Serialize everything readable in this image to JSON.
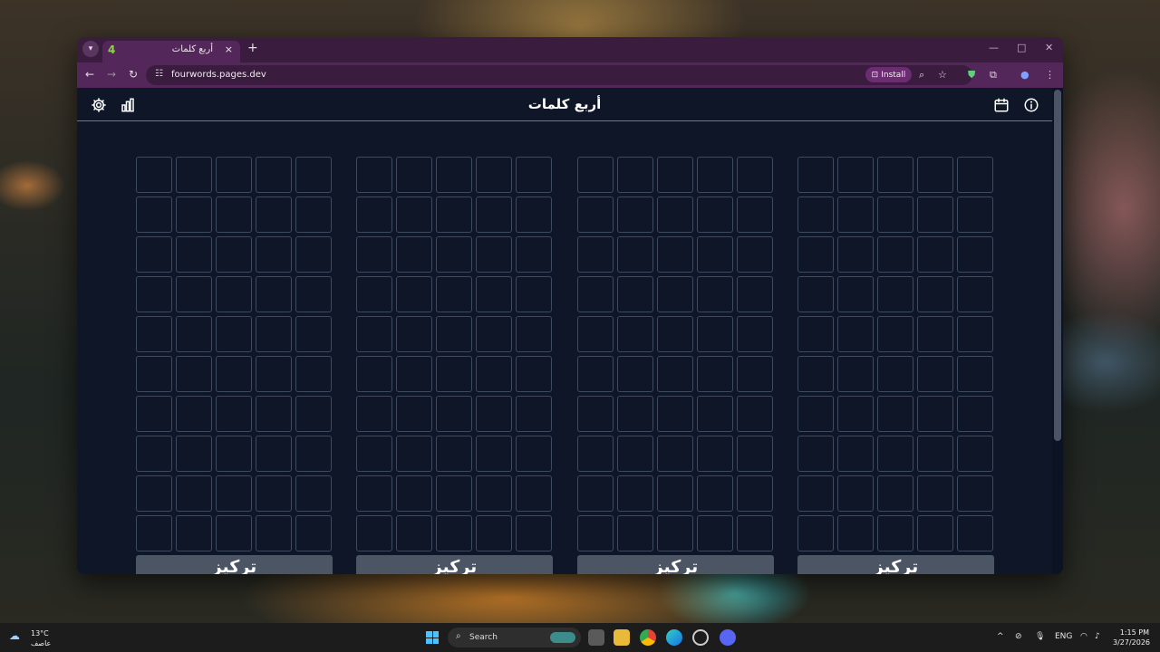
{
  "browser": {
    "tab_title": "أربع كلمات",
    "tab_close": "×",
    "new_tab": "+",
    "url": "fourwords.pages.dev",
    "install_label": "Install"
  },
  "app": {
    "title": "أربع كلمات",
    "focus_label": "تركيز",
    "board_count": 4,
    "rows": 10,
    "cols": 5
  },
  "taskbar": {
    "temperature": "13°C",
    "condition": "عاصف",
    "search_placeholder": "Search",
    "language": "ENG",
    "time": "1:15 PM",
    "date": "3/27/2026"
  },
  "colors": {
    "page_bg": "#0e1628",
    "cell_border": "#3c4b60",
    "focus_button": "#4b5563",
    "browser_chrome": "#54275a"
  }
}
